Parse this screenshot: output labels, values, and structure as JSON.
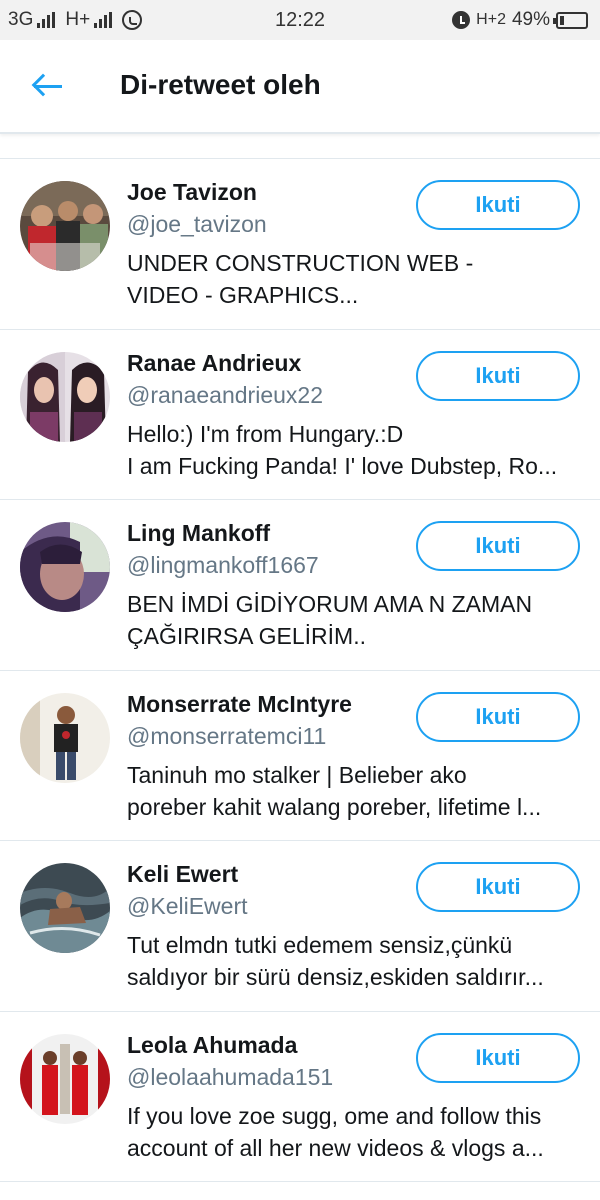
{
  "status_bar": {
    "network1": "3G",
    "network2": "H+",
    "time": "12:22",
    "network3": "H+2",
    "battery_percent": "49%"
  },
  "header": {
    "title": "Di-retweet oleh",
    "back_icon": "arrow-left-icon",
    "accent_color": "#1da1f2"
  },
  "follow_label": "Ikuti",
  "users": [
    {
      "name": "Joe Tavizon",
      "handle": "@joe_tavizon",
      "bio_line1": "UNDER CONSTRUCTION                  WEB -",
      "bio_line2": "VIDEO - GRAPHICS..."
    },
    {
      "name": "Ranae Andrieux",
      "handle": "@ranaeandrieux22",
      "bio_line1": "Hello:) I'm from Hungary.:D",
      "bio_line2": "I am Fucking Panda! I' love Dubstep, Ro..."
    },
    {
      "name": "Ling Mankoff",
      "handle": "@lingmankoff1667",
      "bio_line1": "BEN İMDİ GİDİYORUM AMA N ZAMAN",
      "bio_line2": "ÇAĞIRIRSA GELİRİM.."
    },
    {
      "name": "Monserrate McIntyre",
      "handle": "@monserratemci11",
      "bio_line1": "Taninuh mo stalker | Belieber ako",
      "bio_line2": "poreber kahit walang poreber, lifetime l..."
    },
    {
      "name": "Keli Ewert",
      "handle": "@KeliEwert",
      "bio_line1": "Tut elmdn tutki edemem sensiz,çünkü",
      "bio_line2": "saldıyor bir sürü densiz,eskiden saldırır..."
    },
    {
      "name": "Leola Ahumada",
      "handle": "@leolaahumada151",
      "bio_line1": "If you love zoe sugg, ome and follow this",
      "bio_line2": "account of all her new videos & vlogs a..."
    }
  ]
}
